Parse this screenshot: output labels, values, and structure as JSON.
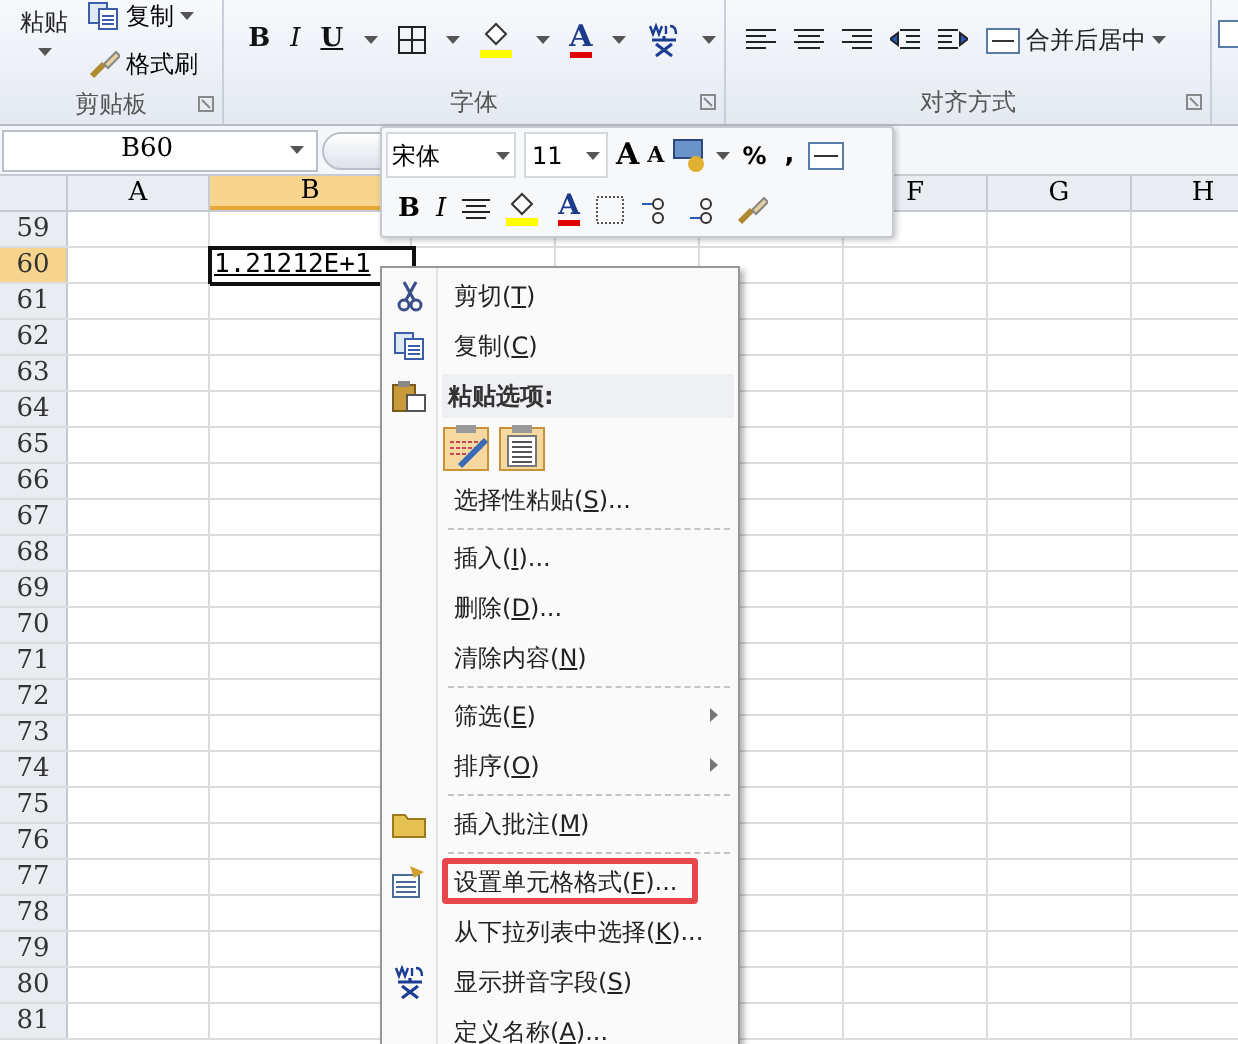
{
  "ribbon": {
    "clipboard": {
      "paste": "粘贴",
      "copy": "复制",
      "format_painter": "格式刷"
    },
    "font_buttons": [
      "B",
      "I",
      "U"
    ],
    "font_color": "A",
    "merge": "合并后居中",
    "groups": [
      {
        "label": "剪贴板"
      },
      {
        "label": "字体"
      },
      {
        "label": "对齐方式"
      }
    ]
  },
  "name_box": {
    "value": "B60"
  },
  "mini_toolbar": {
    "font": "宋体",
    "size": "11",
    "grow": "A",
    "shrink": "A",
    "percent": "%",
    "comma": ",",
    "bold": "B",
    "italic": "I",
    "font_color": "A"
  },
  "sheet": {
    "columns": [
      {
        "label": "A",
        "selected": false
      },
      {
        "label": "B",
        "selected": true
      },
      {
        "label": "F",
        "selected": false
      },
      {
        "label": "G",
        "selected": false
      },
      {
        "label": "H",
        "selected": false
      }
    ],
    "rows": [
      {
        "label": "59",
        "selected": false
      },
      {
        "label": "60",
        "selected": true
      },
      {
        "label": "61",
        "selected": false
      },
      {
        "label": "62",
        "selected": false
      },
      {
        "label": "63",
        "selected": false
      },
      {
        "label": "64",
        "selected": false
      },
      {
        "label": "65",
        "selected": false
      },
      {
        "label": "66",
        "selected": false
      },
      {
        "label": "67",
        "selected": false
      },
      {
        "label": "68",
        "selected": false
      },
      {
        "label": "69",
        "selected": false
      },
      {
        "label": "70",
        "selected": false
      },
      {
        "label": "71",
        "selected": false
      },
      {
        "label": "72",
        "selected": false
      },
      {
        "label": "73",
        "selected": false
      },
      {
        "label": "74",
        "selected": false
      },
      {
        "label": "75",
        "selected": false
      },
      {
        "label": "76",
        "selected": false
      },
      {
        "label": "77",
        "selected": false
      },
      {
        "label": "78",
        "selected": false
      },
      {
        "label": "79",
        "selected": false
      },
      {
        "label": "80",
        "selected": false
      },
      {
        "label": "81",
        "selected": false
      }
    ],
    "active_cell": {
      "value": "1.21212E+1"
    }
  },
  "context_menu": {
    "items": [
      {
        "kind": "item",
        "label": "剪切(T)",
        "submenu": false,
        "highlighted": false
      },
      {
        "kind": "item",
        "label": "复制(C)",
        "submenu": false,
        "highlighted": false
      },
      {
        "kind": "header",
        "label": "粘贴选项:"
      },
      {
        "kind": "paste_icons"
      },
      {
        "kind": "item",
        "label": "选择性粘贴(S)...",
        "submenu": false,
        "highlighted": false
      },
      {
        "kind": "separator"
      },
      {
        "kind": "item",
        "label": "插入(I)...",
        "submenu": false,
        "highlighted": false
      },
      {
        "kind": "item",
        "label": "删除(D)...",
        "submenu": false,
        "highlighted": false
      },
      {
        "kind": "item",
        "label": "清除内容(N)",
        "submenu": false,
        "highlighted": false
      },
      {
        "kind": "separator"
      },
      {
        "kind": "item",
        "label": "筛选(E)",
        "submenu": true,
        "highlighted": false
      },
      {
        "kind": "item",
        "label": "排序(O)",
        "submenu": true,
        "highlighted": false
      },
      {
        "kind": "separator"
      },
      {
        "kind": "item",
        "label": "插入批注(M)",
        "submenu": false,
        "highlighted": false
      },
      {
        "kind": "separator"
      },
      {
        "kind": "item",
        "label": "设置单元格格式(F)...",
        "submenu": false,
        "highlighted": true
      },
      {
        "kind": "item",
        "label": "从下拉列表中选择(K)...",
        "submenu": false,
        "highlighted": false
      },
      {
        "kind": "item",
        "label": "显示拼音字段(S)",
        "submenu": false,
        "highlighted": false
      },
      {
        "kind": "item",
        "label": "定义名称(A)...",
        "submenu": false,
        "highlighted": false
      }
    ]
  }
}
